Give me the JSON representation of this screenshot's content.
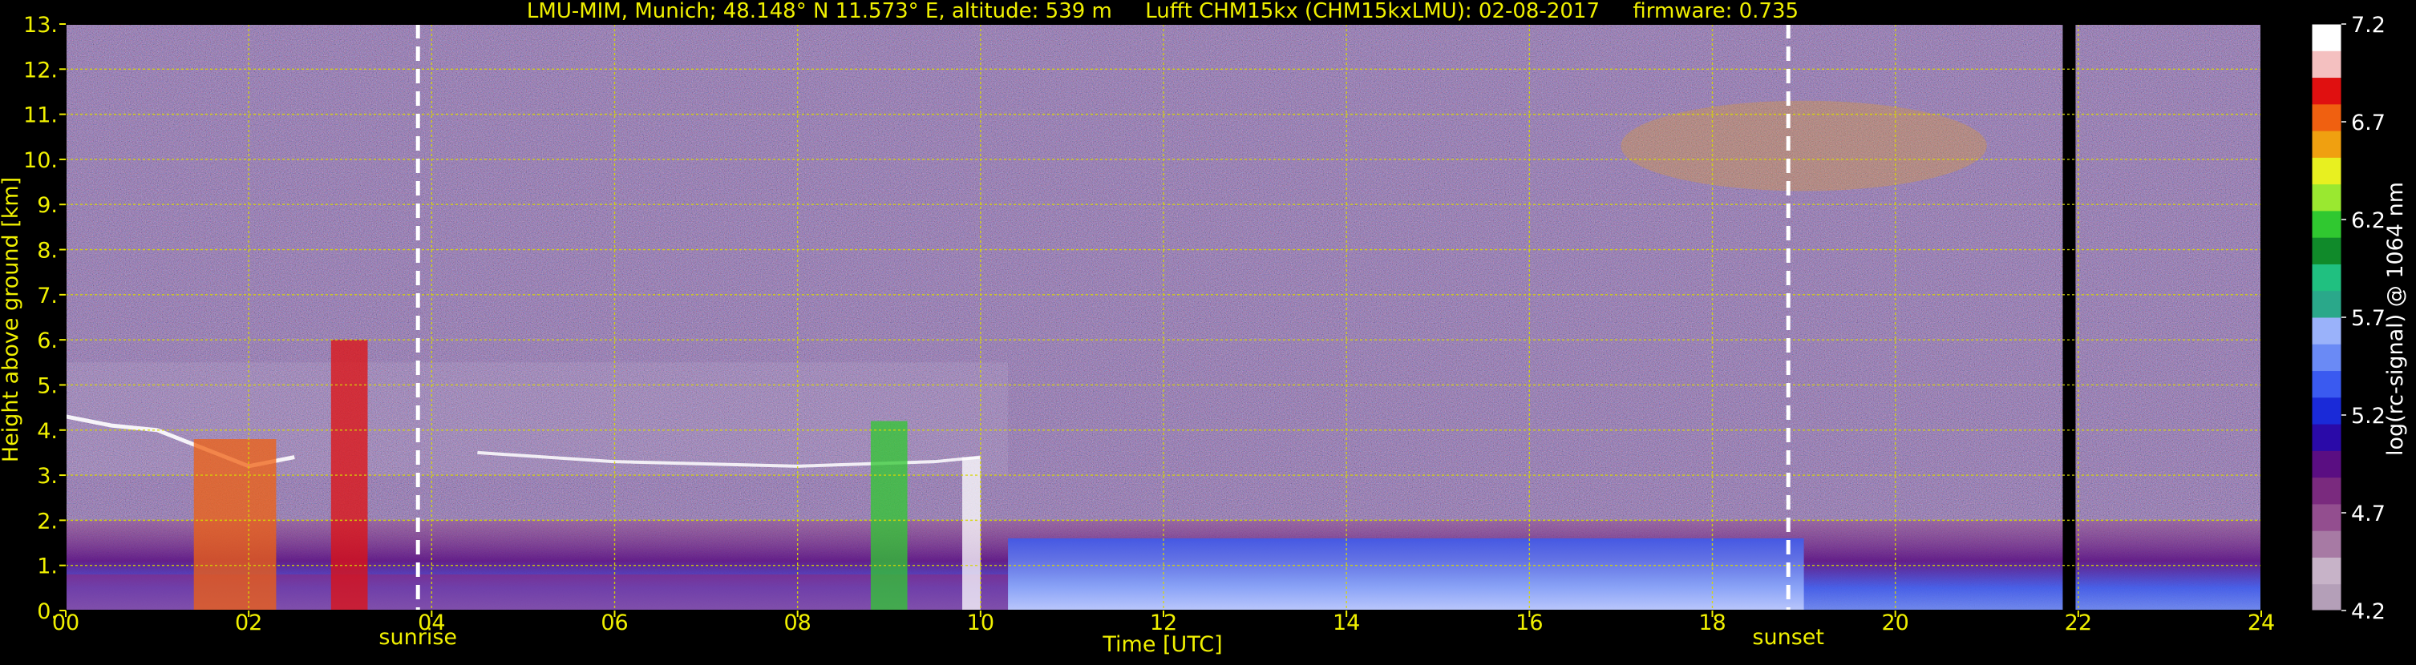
{
  "chart_data": {
    "type": "heatmap",
    "title": "LMU-MIM, Munich; 48.148° N 11.573° E, altitude: 539 m     Lufft CHM15kx (CHM15kxLMU): 02-08-2017     firmware: 0.735",
    "xlabel": "Time [UTC]",
    "ylabel": "Height above ground [km]",
    "xlim": [
      0,
      24
    ],
    "ylim": [
      0,
      13
    ],
    "x_ticks": [
      "00",
      "02",
      "04",
      "06",
      "08",
      "10",
      "12",
      "14",
      "16",
      "18",
      "20",
      "22",
      "24"
    ],
    "y_ticks": [
      "0.",
      "1.",
      "2.",
      "3.",
      "4.",
      "5.",
      "6.",
      "7.",
      "8.",
      "9.",
      "10.",
      "11.",
      "12.",
      "13."
    ],
    "grid": true,
    "markers": [
      {
        "label": "sunrise",
        "x": 3.85
      },
      {
        "label": "sunset",
        "x": 18.83
      }
    ],
    "data_gap": {
      "x_start": 21.83,
      "x_end": 21.97
    },
    "colorbar": {
      "label": "log(rc-signal) @ 1064 nm",
      "range": [
        4.2,
        7.2
      ],
      "tick_labels": [
        "4.2",
        "4.7",
        "5.2",
        "5.7",
        "6.2",
        "6.7",
        "7.2"
      ],
      "colors": [
        "#b49fb8",
        "#c7b3c8",
        "#a77aa4",
        "#934e8f",
        "#7a2a7e",
        "#5a0e82",
        "#2a0aa8",
        "#1a2ad8",
        "#3a5af0",
        "#6a8af5",
        "#9ab2fa",
        "#2aa88a",
        "#20c080",
        "#108a2a",
        "#30c830",
        "#9ae830",
        "#e8f020",
        "#f0a010",
        "#f06010",
        "#e01010",
        "#f4c0c0",
        "#ffffff"
      ]
    },
    "features": [
      {
        "name": "boundary layer",
        "x_range": [
          0,
          24
        ],
        "y_range": [
          0,
          2.0
        ]
      },
      {
        "name": "cloud layer",
        "x_range": [
          0,
          10.3
        ],
        "y_range": [
          3.0,
          5.5
        ]
      },
      {
        "name": "cirrus",
        "x_range": [
          17.0,
          21.0
        ],
        "y_range": [
          9.3,
          11.3
        ]
      }
    ]
  }
}
